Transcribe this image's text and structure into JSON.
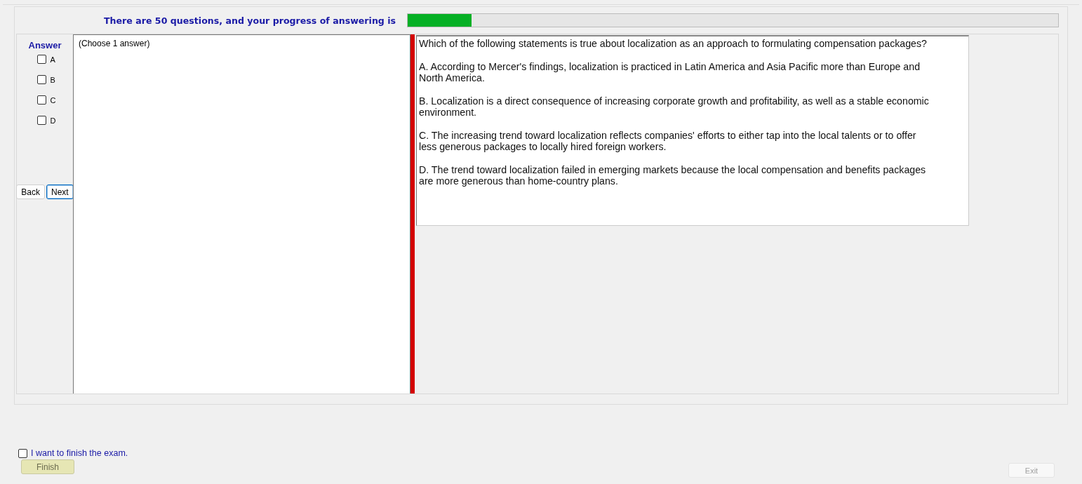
{
  "header": {
    "text": "There are 50 questions, and your progress of answering is",
    "progress": {
      "level": 0.098
    }
  },
  "answer_panel": {
    "title": "Answer",
    "options": [
      {
        "label": "A",
        "checked": false
      },
      {
        "label": "B",
        "checked": false
      },
      {
        "label": "C",
        "checked": false
      },
      {
        "label": "D",
        "checked": false
      }
    ],
    "buttons": [
      {
        "label": "Back",
        "focused": false
      },
      {
        "label": "Next",
        "focused": true
      }
    ]
  },
  "choice_hint": "(Choose 1 answer)",
  "question": {
    "paragraphs": [
      "Which of the following statements is true about localization as an approach to formulating compensation packages?",
      "A.  According to Mercer's findings, localization is practiced in Latin America and Asia Pacific more than Europe and North America.",
      "B.  Localization is a direct consequence of increasing corporate growth and profitability, as well as a stable economic environment.",
      "C.  The increasing trend toward localization reflects companies' efforts to either tap into the local talents or to offer less generous packages to locally hired foreign workers.",
      "D.  The trend toward localization failed in emerging markets because the local compensation and benefits packages are more generous than home-country plans."
    ]
  },
  "finish": {
    "label": "I want to finish the exam.",
    "checked": false,
    "button": {
      "label": "Finish",
      "disabled": true
    }
  },
  "exit_button": {
    "label": "Exit",
    "disabled": true
  }
}
